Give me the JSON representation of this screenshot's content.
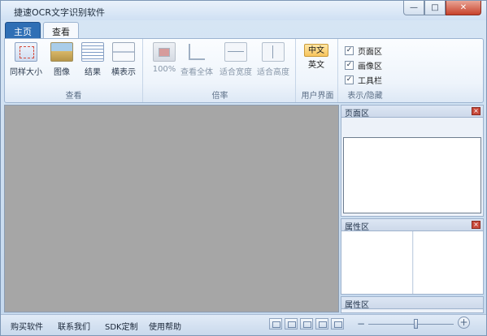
{
  "window": {
    "title": "捷速OCR文字识别软件",
    "buttons": {
      "minimize": "—",
      "maximize": "□",
      "close": "✕"
    }
  },
  "tabs": [
    {
      "label": "主页"
    },
    {
      "label": "查看"
    }
  ],
  "ribbon": {
    "view_group": {
      "label": "查看",
      "buttons": [
        {
          "label": "同样大小",
          "icon": "same-size-icon"
        },
        {
          "label": "图像",
          "icon": "image-icon"
        },
        {
          "label": "结果",
          "icon": "result-icon"
        },
        {
          "label": "横表示",
          "icon": "horizontal-icon"
        }
      ]
    },
    "zoom_group": {
      "label": "倍率",
      "buttons": [
        {
          "label": "100%",
          "icon": "zoom-100-icon"
        },
        {
          "label": "查看全体",
          "icon": "view-all-icon"
        },
        {
          "label": "适合宽度",
          "icon": "fit-width-icon"
        },
        {
          "label": "适合高度",
          "icon": "fit-height-icon"
        }
      ]
    },
    "ui_group": {
      "label": "用户界面",
      "chinese": "中文",
      "english": "英文"
    },
    "show_group": {
      "label": "表示/隐藏",
      "checkboxes": [
        {
          "label": "页面区",
          "checked": "✓"
        },
        {
          "label": "画像区",
          "checked": "✓"
        },
        {
          "label": "工具栏",
          "checked": "✓"
        }
      ]
    }
  },
  "panels": {
    "page_area": {
      "title": "页面区",
      "close": "×"
    },
    "property_area": {
      "title": "属性区",
      "close": "×"
    },
    "property_area_2": {
      "title": "属性区"
    }
  },
  "statusbar": {
    "links": [
      "购买软件",
      "联系我们",
      "SDK定制",
      "使用帮助"
    ],
    "zoom_minus": "−",
    "zoom_plus": "+"
  },
  "colors": {
    "accent": "#2f6fb5",
    "canvas": "#a6a6a6",
    "selected_lang": "#f7c45c"
  }
}
